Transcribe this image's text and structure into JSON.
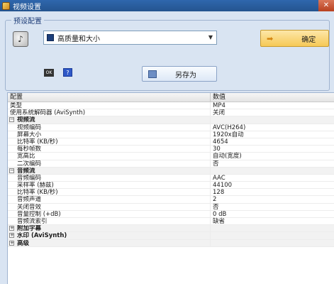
{
  "window": {
    "title": "视频设置",
    "close_glyph": "✕"
  },
  "preset": {
    "group_title": "预设配置",
    "selected": "高质量和大小",
    "ok_label": "确定",
    "saveas_label": "另存为",
    "help_glyph": "?",
    "small_icon_text": "OK"
  },
  "grid": {
    "headers": {
      "name": "配置",
      "value": "数值"
    },
    "rows": [
      {
        "kind": "top",
        "label": "类型",
        "value": "MP4"
      },
      {
        "kind": "top",
        "label": "使用系统解码器 (AviSynth)",
        "value": "关闭"
      },
      {
        "kind": "cat",
        "label": "视频流",
        "toggle": "−"
      },
      {
        "kind": "item",
        "label": "视频编码",
        "value": "AVC(H264)"
      },
      {
        "kind": "item",
        "label": "屏幕大小",
        "value": "1920x自动"
      },
      {
        "kind": "item",
        "label": "比特率 (KB/秒)",
        "value": "4654"
      },
      {
        "kind": "item",
        "label": "每秒帧数",
        "value": "30"
      },
      {
        "kind": "item",
        "label": "宽高比",
        "value": "自动(宽度)"
      },
      {
        "kind": "item",
        "label": "二次编码",
        "value": "否"
      },
      {
        "kind": "cat",
        "label": "音频流",
        "toggle": "−"
      },
      {
        "kind": "item",
        "label": "音频编码",
        "value": "AAC"
      },
      {
        "kind": "item",
        "label": "采样率 (赫兹)",
        "value": "44100"
      },
      {
        "kind": "item",
        "label": "比特率 (KB/秒)",
        "value": "128"
      },
      {
        "kind": "item",
        "label": "音频声道",
        "value": "2"
      },
      {
        "kind": "item",
        "label": "关闭音效",
        "value": "否"
      },
      {
        "kind": "item",
        "label": "音量控制 (+dB)",
        "value": "0 dB"
      },
      {
        "kind": "item",
        "label": "音频流索引",
        "value": "缺省"
      },
      {
        "kind": "cat",
        "label": "附加字幕",
        "toggle": "+"
      },
      {
        "kind": "cat",
        "label": "水印 (AviSynth)",
        "toggle": "+"
      },
      {
        "kind": "cat",
        "label": "高级",
        "toggle": "+"
      }
    ]
  }
}
